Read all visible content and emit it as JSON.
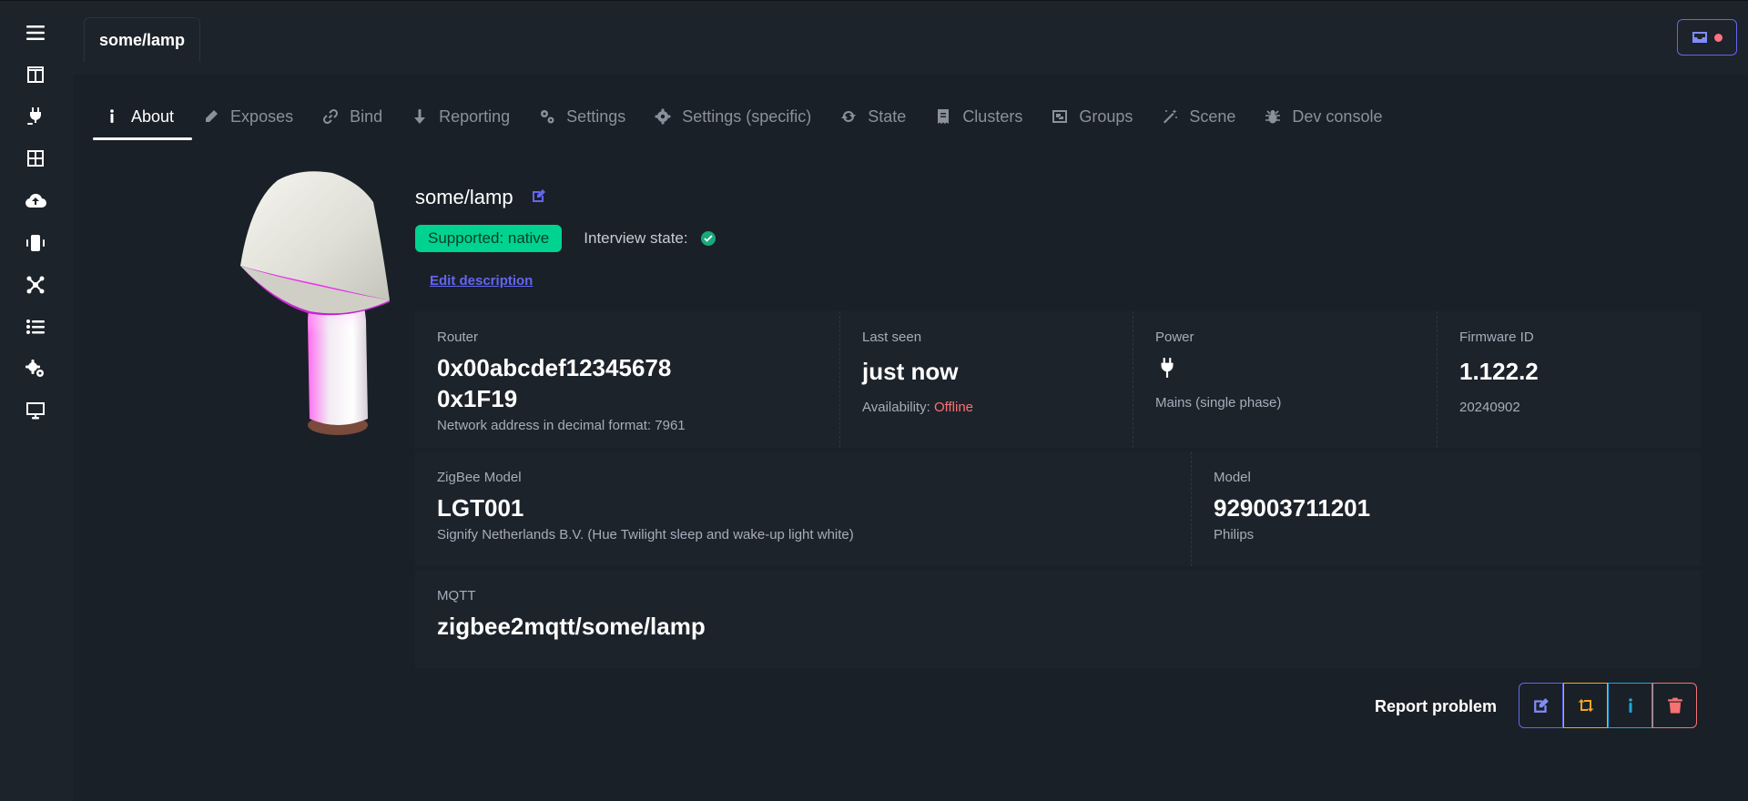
{
  "top_tab": {
    "label": "some/lamp"
  },
  "sidebar": {
    "items": [
      {
        "icon": "menu-icon"
      },
      {
        "icon": "dashboard-icon"
      },
      {
        "icon": "plug-icon"
      },
      {
        "icon": "grid-icon"
      },
      {
        "icon": "cloud-upload-icon"
      },
      {
        "icon": "vibrate-phone-icon"
      },
      {
        "icon": "network-icon"
      },
      {
        "icon": "list-icon"
      },
      {
        "icon": "gears-icon"
      },
      {
        "icon": "monitor-icon"
      }
    ]
  },
  "tabs": [
    {
      "label": "About",
      "icon": "info-icon",
      "active": true
    },
    {
      "label": "Exposes",
      "icon": "pencil-icon"
    },
    {
      "label": "Bind",
      "icon": "link-icon"
    },
    {
      "label": "Reporting",
      "icon": "arrow-down-icon"
    },
    {
      "label": "Settings",
      "icon": "gears-icon"
    },
    {
      "label": "Settings (specific)",
      "icon": "gear-icon"
    },
    {
      "label": "State",
      "icon": "refresh-icon"
    },
    {
      "label": "Clusters",
      "icon": "receipt-icon"
    },
    {
      "label": "Groups",
      "icon": "object-group-icon"
    },
    {
      "label": "Scene",
      "icon": "magic-wand-icon"
    },
    {
      "label": "Dev console",
      "icon": "bug-icon"
    }
  ],
  "device": {
    "name": "some/lamp",
    "support_badge": "Supported: native",
    "interview_label": "Interview state:",
    "edit_description": "Edit description"
  },
  "stats_row1": {
    "router": {
      "title": "Router",
      "value_line1": "0x00abcdef12345678",
      "value_line2": "0x1F19",
      "desc": "Network address in decimal format: 7961"
    },
    "last_seen": {
      "title": "Last seen",
      "value": "just now",
      "availability_label": "Availability:",
      "availability_value": "Offline"
    },
    "power": {
      "title": "Power",
      "desc": "Mains (single phase)"
    },
    "firmware": {
      "title": "Firmware ID",
      "value": "1.122.2",
      "desc": "20240902"
    }
  },
  "stats_row2": {
    "zigbee_model": {
      "title": "ZigBee Model",
      "value": "LGT001",
      "desc": "Signify Netherlands B.V. (Hue Twilight sleep and wake-up light white)"
    },
    "model": {
      "title": "Model",
      "value": "929003711201",
      "desc": "Philips"
    }
  },
  "mqtt": {
    "title": "MQTT",
    "value": "zigbee2mqtt/some/lamp"
  },
  "actions": {
    "report_problem": "Report problem"
  },
  "colors": {
    "accent": "#6366f1",
    "success": "#00d390",
    "warning": "#f5a524",
    "info": "#22a6d8",
    "error": "#f87272"
  }
}
